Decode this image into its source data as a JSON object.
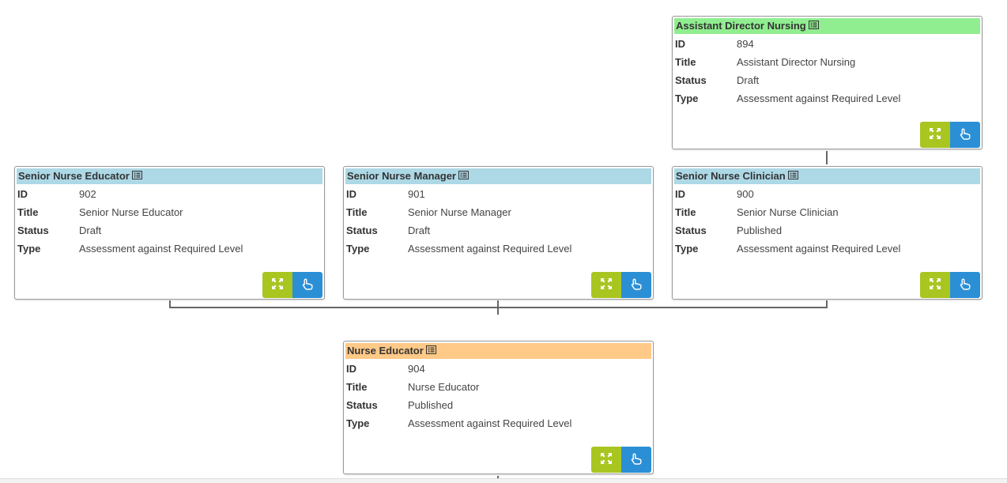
{
  "colors": {
    "header_green": "#90ee90",
    "header_blue": "#add8e6",
    "header_orange": "#ffc987",
    "expand_button": "#a8c520",
    "select_button": "#2b8fd6"
  },
  "labels": {
    "id": "ID",
    "title": "Title",
    "status": "Status",
    "type": "Type"
  },
  "icons": {
    "header": "details-list-icon",
    "expand": "expand-icon",
    "select": "pointer-hand-icon"
  },
  "cards": [
    {
      "header": "Assistant Director Nursing",
      "id": "894",
      "title": "Assistant Director Nursing",
      "status": "Draft",
      "type": "Assessment against Required Level"
    },
    {
      "header": "Senior Nurse Educator",
      "id": "902",
      "title": "Senior Nurse Educator",
      "status": "Draft",
      "type": "Assessment against Required Level"
    },
    {
      "header": "Senior Nurse Manager",
      "id": "901",
      "title": "Senior Nurse Manager",
      "status": "Draft",
      "type": "Assessment against Required Level"
    },
    {
      "header": "Senior Nurse Clinician",
      "id": "900",
      "title": "Senior Nurse Clinician",
      "status": "Published",
      "type": "Assessment against Required Level"
    },
    {
      "header": "Nurse Educator",
      "id": "904",
      "title": "Nurse Educator",
      "status": "Published",
      "type": "Assessment against Required Level"
    }
  ]
}
